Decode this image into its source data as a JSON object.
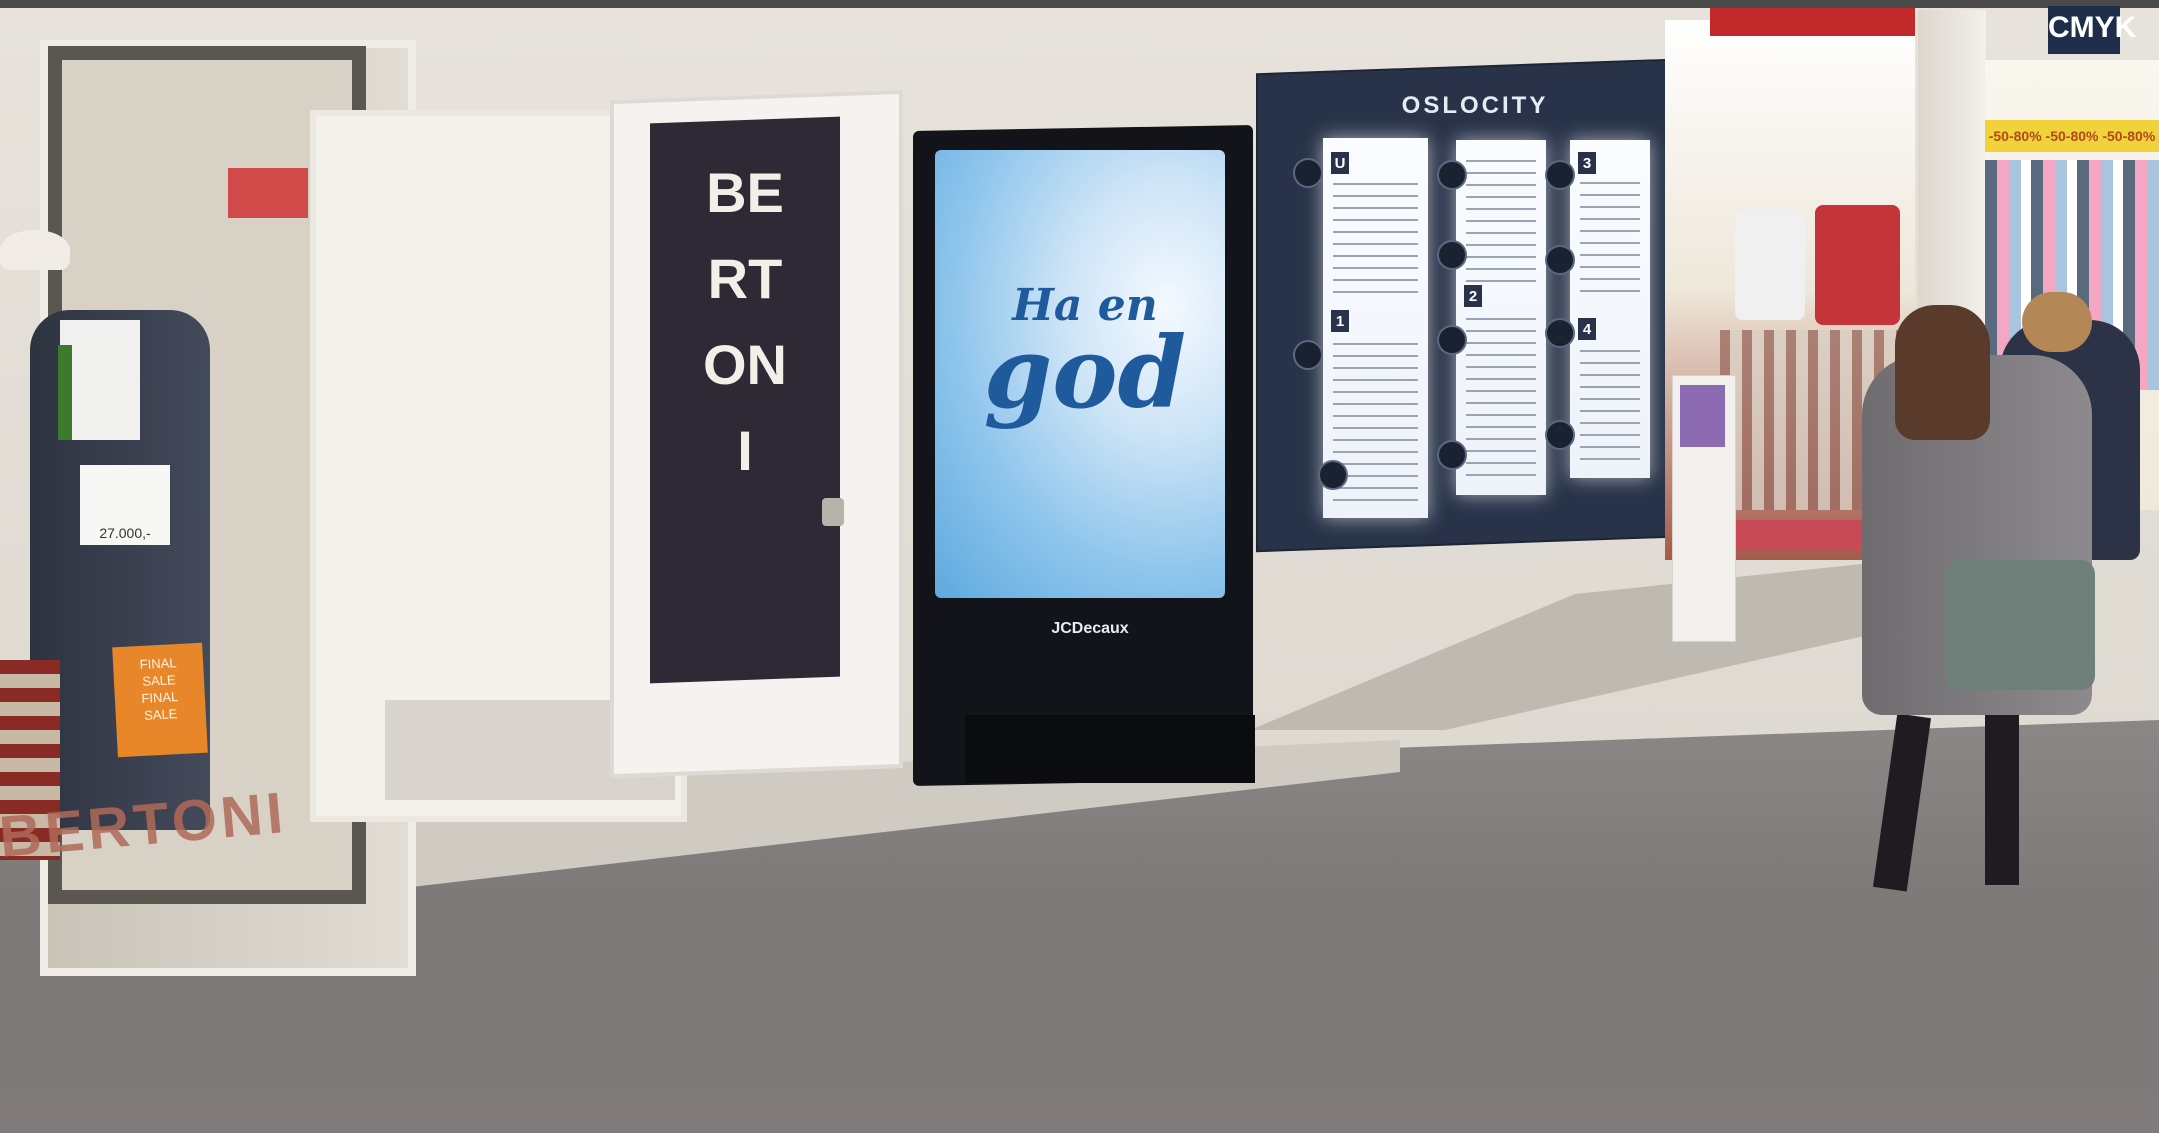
{
  "scene": {
    "window_sticker": "",
    "price_tag": "27.000,-",
    "sale_sign": [
      "FINAL",
      "SALE",
      "FINAL",
      "SALE"
    ],
    "window_logo": "BERTONI",
    "door_banner": "BERTONI",
    "screen": {
      "line1": "Ha en",
      "line2": "god",
      "brand": "JCDecaux"
    },
    "directory": {
      "title": "OSLOCITY",
      "sections": [
        "U",
        "1",
        "2",
        "3",
        "4"
      ]
    },
    "right_store_sign": "",
    "cmyk_sign": "CMYK",
    "cmyk_banner": "-50-80% -50-80% -50-80%"
  }
}
